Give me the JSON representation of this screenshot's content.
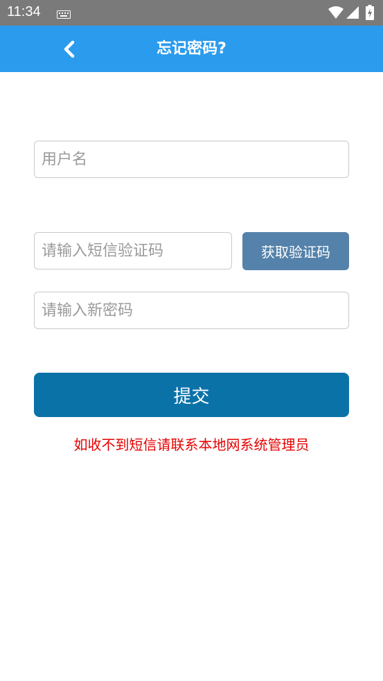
{
  "status_bar": {
    "time": "11:34",
    "icons": [
      "keyboard-icon",
      "wifi-icon",
      "signal-icon",
      "battery-icon"
    ]
  },
  "app_bar": {
    "title": "忘记密码?",
    "back_icon": "chevron-left-icon",
    "color": "#2b9bed"
  },
  "form": {
    "username_placeholder": "用户名",
    "sms_code_placeholder": "请输入短信验证码",
    "get_code_label": "获取验证码",
    "new_password_placeholder": "请输入新密码",
    "submit_label": "提交",
    "help_text": "如收不到短信请联系本地网系统管理员"
  },
  "colors": {
    "get_code_button": "#5582aa",
    "submit_button": "#0b72a8",
    "help_text": "#e60000"
  }
}
